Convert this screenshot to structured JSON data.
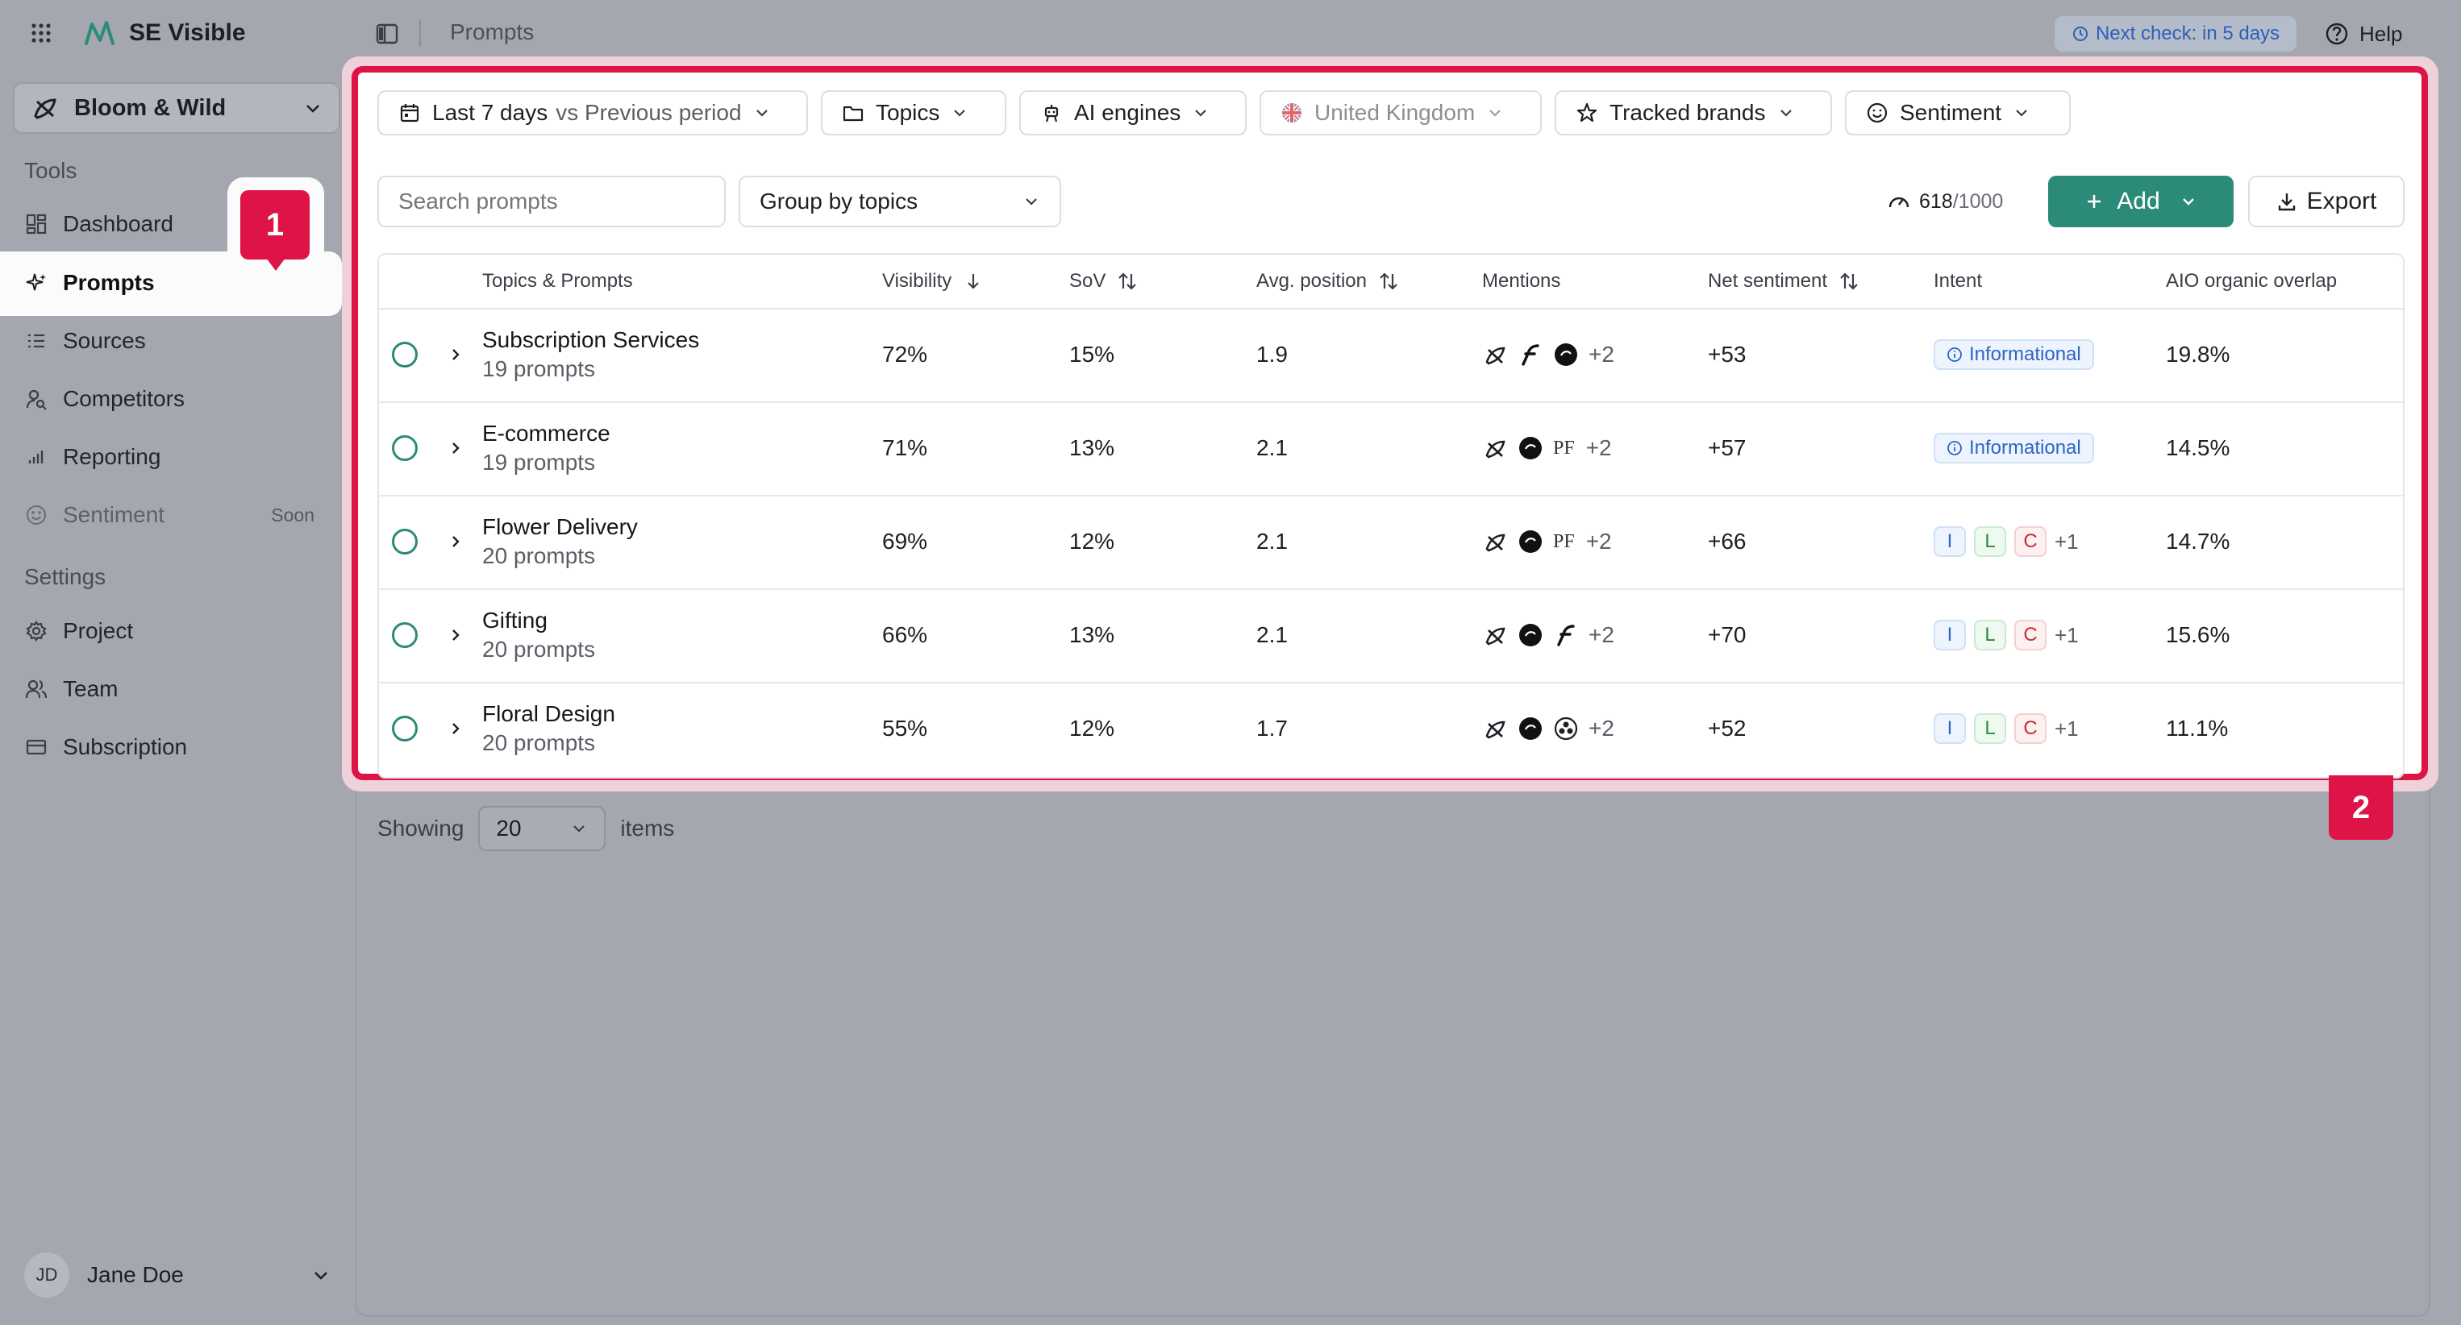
{
  "app": {
    "name": "SE Visible",
    "breadcrumb": "Prompts"
  },
  "workspace": {
    "name": "Bloom & Wild"
  },
  "sidebar": {
    "tools_heading": "Tools",
    "tools": [
      {
        "label": "Dashboard",
        "icon": "dashboard-icon"
      },
      {
        "label": "Prompts",
        "icon": "sparkle-icon",
        "active": true
      },
      {
        "label": "Sources",
        "icon": "list-icon"
      },
      {
        "label": "Competitors",
        "icon": "user-search-icon"
      },
      {
        "label": "Reporting",
        "icon": "bar-chart-icon"
      },
      {
        "label": "Sentiment",
        "icon": "smile-icon",
        "badge": "Soon",
        "disabled": true
      }
    ],
    "settings_heading": "Settings",
    "settings": [
      {
        "label": "Project",
        "icon": "gear-icon"
      },
      {
        "label": "Team",
        "icon": "team-icon"
      },
      {
        "label": "Subscription",
        "icon": "card-icon"
      }
    ],
    "user": {
      "initials": "JD",
      "name": "Jane Doe"
    }
  },
  "header": {
    "next_check": "Next check: in 5 days",
    "help": "Help"
  },
  "filters": {
    "period_main": "Last 7 days",
    "period_compare": "vs Previous period",
    "topics": "Topics",
    "ai_engines": "AI engines",
    "country": "United Kingdom",
    "tracked_brands": "Tracked brands",
    "sentiment": "Sentiment"
  },
  "toolbar": {
    "search_placeholder": "Search prompts",
    "group_by": "Group by topics",
    "usage_used": "618",
    "usage_total": "/1000",
    "add": "Add",
    "export": "Export"
  },
  "table": {
    "columns": {
      "topics": "Topics & Prompts",
      "visibility": "Visibility",
      "sov": "SoV",
      "avg_position": "Avg. position",
      "mentions": "Mentions",
      "net_sentiment": "Net sentiment",
      "intent": "Intent",
      "aio_overlap": "AIO organic overlap"
    },
    "rows": [
      {
        "name": "Subscription Services",
        "prompts": "19 prompts",
        "visibility": "72%",
        "sov": "15%",
        "avg_position": "1.9",
        "mentions_more": "+2",
        "net_sentiment": "+53",
        "intent": "Informational",
        "aio": "19.8%"
      },
      {
        "name": "E-commerce",
        "prompts": "19 prompts",
        "visibility": "71%",
        "sov": "13%",
        "avg_position": "2.1",
        "mentions_more": "+2",
        "net_sentiment": "+57",
        "intent": "Informational",
        "aio": "14.5%"
      },
      {
        "name": "Flower Delivery",
        "prompts": "20 prompts",
        "visibility": "69%",
        "sov": "12%",
        "avg_position": "2.1",
        "mentions_more": "+2",
        "net_sentiment": "+66",
        "intent_tags": [
          "I",
          "L",
          "C"
        ],
        "intent_more": "+1",
        "aio": "14.7%"
      },
      {
        "name": "Gifting",
        "prompts": "20 prompts",
        "visibility": "66%",
        "sov": "13%",
        "avg_position": "2.1",
        "mentions_more": "+2",
        "net_sentiment": "+70",
        "intent_tags": [
          "I",
          "L",
          "C"
        ],
        "intent_more": "+1",
        "aio": "15.6%"
      },
      {
        "name": "Floral Design",
        "prompts": "20 prompts",
        "visibility": "55%",
        "sov": "12%",
        "avg_position": "1.7",
        "mentions_more": "+2",
        "net_sentiment": "+52",
        "intent_tags": [
          "I",
          "L",
          "C"
        ],
        "intent_more": "+1",
        "aio": "11.1%"
      }
    ],
    "mention_pf": "PF"
  },
  "pagination": {
    "showing": "Showing",
    "page_size": "20",
    "items": "items"
  },
  "annotations": {
    "marker1": "1",
    "marker2": "2"
  },
  "colors": {
    "accent": "#2b8a78",
    "highlight": "#dd1445",
    "background": "#a4a7af"
  }
}
